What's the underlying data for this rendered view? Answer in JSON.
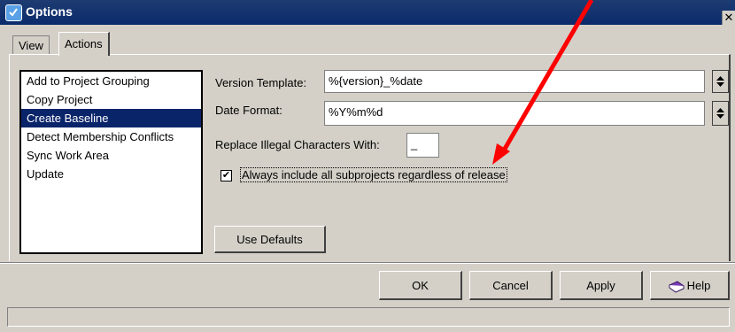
{
  "window": {
    "title": "Options",
    "close_label": "✕"
  },
  "tabs": [
    {
      "label": "View"
    },
    {
      "label": "Actions"
    }
  ],
  "actions_list": [
    {
      "label": "Add to Project Grouping"
    },
    {
      "label": "Copy Project"
    },
    {
      "label": "Create Baseline",
      "selected": true
    },
    {
      "label": "Detect Membership Conflicts"
    },
    {
      "label": "Sync Work Area"
    },
    {
      "label": "Update"
    }
  ],
  "form": {
    "version_template_label": "Version Template:",
    "version_template_value": "%{version}_%date",
    "date_format_label": "Date Format:",
    "date_format_value": "%Y%m%d",
    "replace_label": "Replace Illegal Characters With:",
    "replace_value": "_",
    "checkbox_label": "Always include all subprojects regardless of release",
    "checkbox_checked": "✔",
    "use_defaults_label": "Use Defaults"
  },
  "buttons": {
    "ok": "OK",
    "cancel": "Cancel",
    "apply": "Apply",
    "help": "Help"
  },
  "colors": {
    "titlebar": "#0a2a6b",
    "selection": "#0a246a",
    "annotation_arrow": "#ff0000"
  },
  "icons": {
    "app": "options-check-icon",
    "help": "help-book-icon",
    "spinner": "up-down-spinner-icon"
  }
}
